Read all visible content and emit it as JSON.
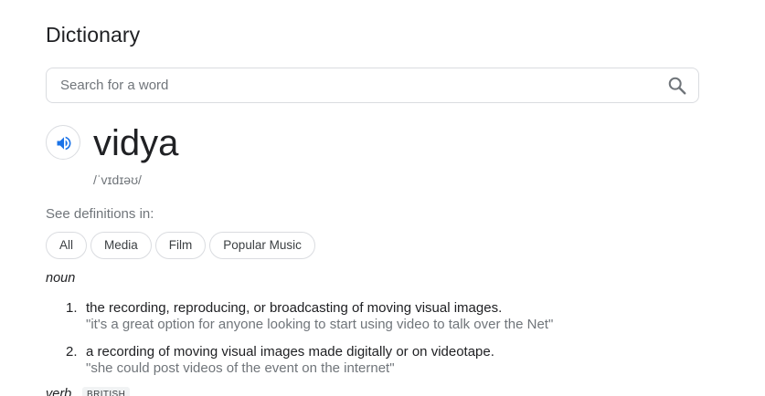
{
  "header": {
    "title": "Dictionary"
  },
  "search": {
    "placeholder": "Search for a word",
    "value": ""
  },
  "entry": {
    "word": "vidya",
    "phonetic": "/ˈvɪdɪəʊ/"
  },
  "see_definitions": {
    "label": "See definitions in:",
    "chips": [
      "All",
      "Media",
      "Film",
      "Popular Music"
    ]
  },
  "senses": [
    {
      "part_of_speech": "noun",
      "definitions": [
        {
          "number": "1.",
          "text": "the recording, reproducing, or broadcasting of moving visual images.",
          "example": "\"it's a great option for anyone looking to start using video to talk over the Net\""
        },
        {
          "number": "2.",
          "text": "a recording of moving visual images made digitally or on videotape.",
          "example": "\"she could post videos of the event on the internet\""
        }
      ]
    },
    {
      "part_of_speech": "verb",
      "badge": "BRITISH"
    }
  ],
  "colors": {
    "accent": "#1a73e8",
    "text": "#202124",
    "muted": "#70757a",
    "border": "#dadce0"
  },
  "icons": {
    "search": "search-icon",
    "speaker": "speaker-icon"
  }
}
